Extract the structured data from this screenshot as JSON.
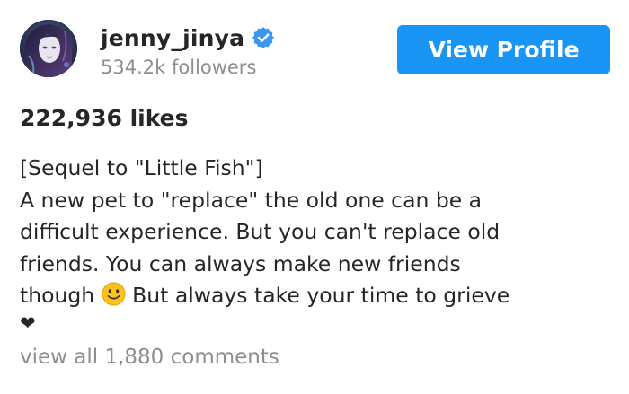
{
  "post": {
    "username": "jenny_jinya",
    "followers": "534.2k followers",
    "view_profile_label": "View Profile",
    "likes": "222,936 likes",
    "caption_line1": "[Sequel to \"Little Fish\"]",
    "caption_line2": "A new pet to \"replace\" the old one can be a",
    "caption_line3": "difficult experience. But you can't replace old",
    "caption_line4": "friends. You can always make new friends",
    "caption_line5a": "though ",
    "caption_line5b": " But always take your time to grieve",
    "heart": "❤",
    "view_comments": "view all 1,880 comments"
  },
  "icons": {
    "verified": "verified-badge-icon",
    "smile": "smiling-face-emoji",
    "heart": "heart-emoji"
  },
  "colors": {
    "button_bg": "#1995f6",
    "text": "#262626",
    "muted": "#8e8e8e",
    "verified": "#3897f0"
  }
}
